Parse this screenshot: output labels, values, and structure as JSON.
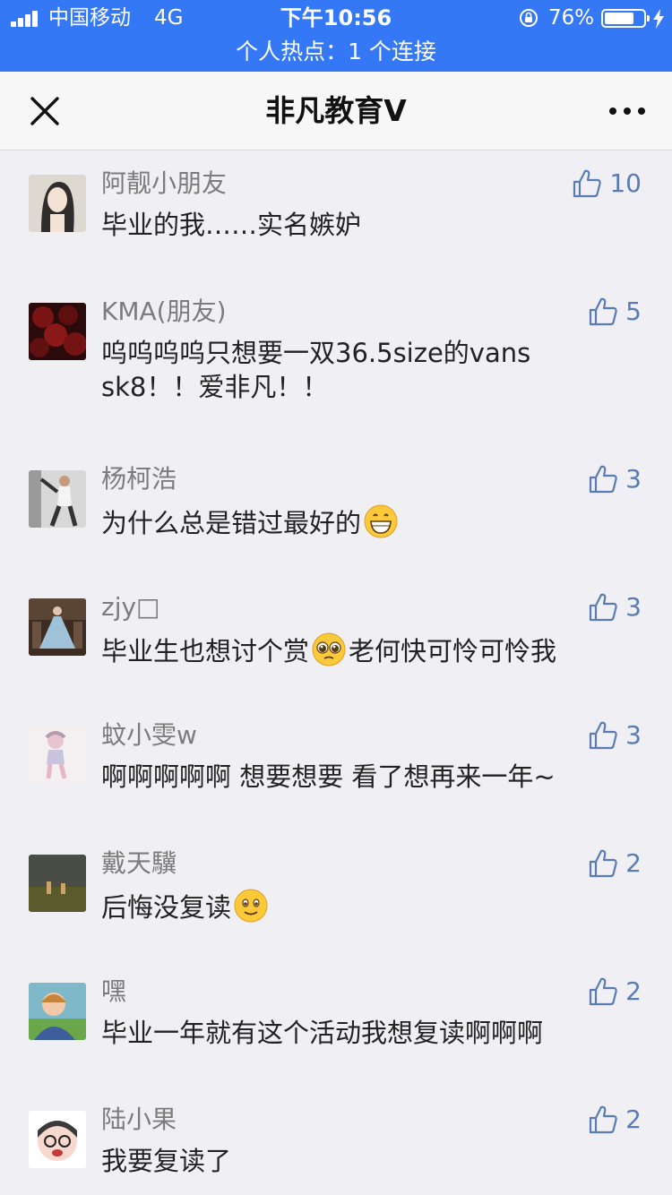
{
  "status_bar": {
    "carrier": "中国移动",
    "network": "4G",
    "time": "下午10:56",
    "battery_pct": "76%",
    "battery_level": 0.76,
    "hotspot": "个人热点：1 个连接"
  },
  "nav": {
    "title": "非凡教育V",
    "close_icon": "close-icon",
    "more_icon": "more-dots-icon"
  },
  "colors": {
    "status_bar_bg": "#3478f6",
    "like_blue": "#5b7cb3",
    "nickname_gray": "#7c7c7c",
    "page_bg": "#efeff4"
  },
  "comments": [
    {
      "nickname": "阿靓小朋友",
      "likes": "10",
      "text": "毕业的我……实名嫉妒"
    },
    {
      "nickname": "KMA(朋友)",
      "likes": "5",
      "text": "呜呜呜呜只想要一双36.5size的vans sk8！！爱非凡！！"
    },
    {
      "nickname": "杨柯浩",
      "likes": "3",
      "text": "为什么总是错过最好的",
      "emoji": "grinning-emoji"
    },
    {
      "nickname": "zjy□",
      "likes": "3",
      "text_before": "毕业生也想讨个赏",
      "text_after": "老何快可怜可怜我",
      "emoji": "pleading-emoji"
    },
    {
      "nickname": "蚊小雯w",
      "likes": "3",
      "text": "啊啊啊啊啊 想要想要 看了想再来一年~"
    },
    {
      "nickname": "戴天驥",
      "likes": "2",
      "text": "后悔没复读",
      "emoji": "smiling-emoji"
    },
    {
      "nickname": "嘿",
      "likes": "2",
      "text": "毕业一年就有这个活动我想复读啊啊啊"
    },
    {
      "nickname": "陆小果",
      "likes": "2",
      "text": "我要复读了"
    }
  ]
}
